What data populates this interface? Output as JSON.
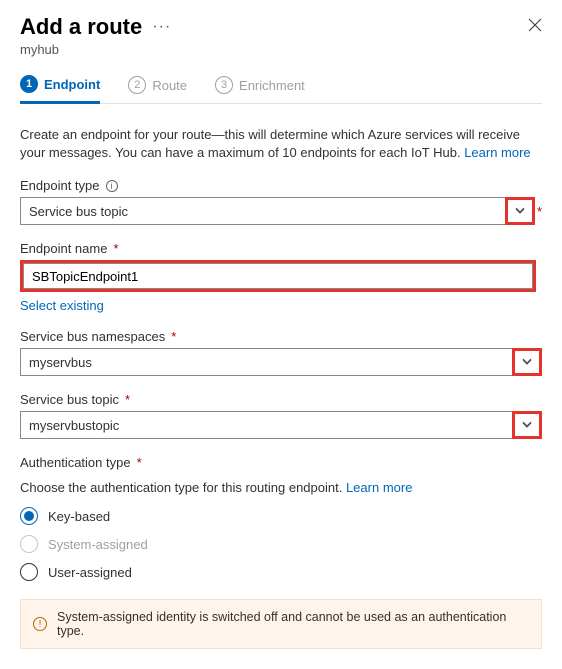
{
  "header": {
    "title": "Add a route",
    "subtitle": "myhub"
  },
  "steps": [
    {
      "num": "1",
      "label": "Endpoint",
      "active": true
    },
    {
      "num": "2",
      "label": "Route",
      "active": false
    },
    {
      "num": "3",
      "label": "Enrichment",
      "active": false
    }
  ],
  "intro": {
    "text": "Create an endpoint for your route—this will determine which Azure services will receive your messages. You can have a maximum of 10 endpoints for each IoT Hub. ",
    "learn_more": "Learn more"
  },
  "fields": {
    "endpoint_type": {
      "label": "Endpoint type",
      "value": "Service bus topic"
    },
    "endpoint_name": {
      "label": "Endpoint name",
      "value": "SBTopicEndpoint1",
      "select_existing": "Select existing"
    },
    "namespace": {
      "label": "Service bus namespaces",
      "value": "myservbus"
    },
    "topic": {
      "label": "Service bus topic",
      "value": "myservbustopic"
    },
    "auth_type": {
      "label": "Authentication type",
      "desc": "Choose the authentication type for this routing endpoint. ",
      "learn_more": "Learn more",
      "options": {
        "key": "Key-based",
        "system": "System-assigned",
        "user": "User-assigned"
      }
    }
  },
  "warning": "System-assigned identity is switched off and cannot be used as an authentication type."
}
